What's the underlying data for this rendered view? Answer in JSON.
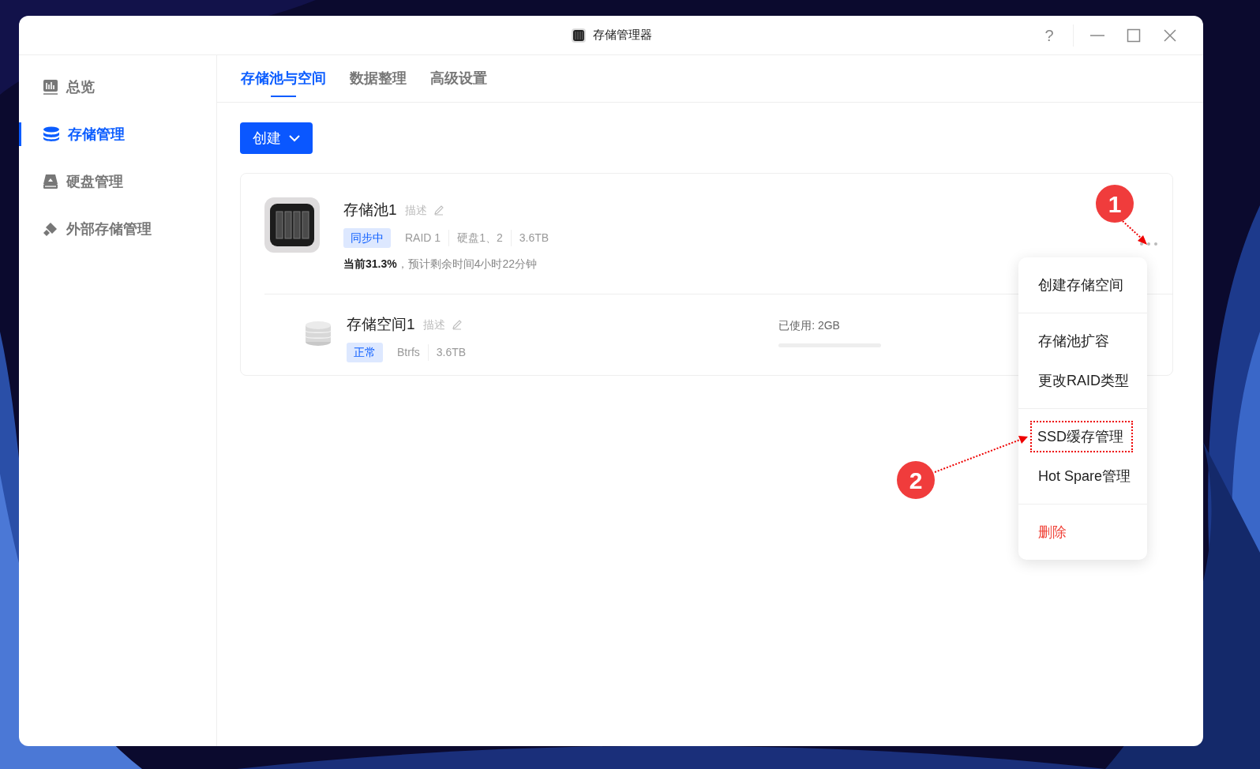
{
  "window": {
    "title": "存储管理器",
    "help": "?"
  },
  "sidebar": {
    "items": [
      {
        "label": "总览",
        "kind": "chart",
        "selected": false
      },
      {
        "label": "存储管理",
        "kind": "database",
        "selected": true
      },
      {
        "label": "硬盘管理",
        "kind": "drive",
        "selected": false
      },
      {
        "label": "外部存储管理",
        "kind": "plug",
        "selected": false
      }
    ]
  },
  "tabs": [
    {
      "label": "存储池与空间",
      "selected": true
    },
    {
      "label": "数据整理",
      "selected": false
    },
    {
      "label": "高级设置",
      "selected": false
    }
  ],
  "create_button": {
    "label": "创建"
  },
  "pool": {
    "name": "存储池1",
    "description": "描述",
    "status": "同步中",
    "raid": "RAID 1",
    "disks": "硬盘1、2",
    "size": "3.6TB",
    "progress": "**当前31.3%**，预计剩余时间4小时22分钟"
  },
  "volume": {
    "name": "存储空间1",
    "description": "描述",
    "status": "正常",
    "filesystem": "Btrfs",
    "size": "3.6TB",
    "used": "已使用: 2GB",
    "level": 0
  },
  "menu": {
    "groups": [
      {
        "items": [
          {
            "label": "创建存储空间",
            "kind": "normal",
            "highlighted": false
          }
        ]
      },
      {
        "items": [
          {
            "label": "存储池扩容",
            "kind": "normal",
            "highlighted": false
          },
          {
            "label": "更改RAID类型",
            "kind": "normal",
            "highlighted": false
          }
        ]
      },
      {
        "items": [
          {
            "label": "SSD缓存管理",
            "kind": "normal",
            "highlighted": true
          },
          {
            "label": "Hot Spare管理",
            "kind": "normal",
            "highlighted": false
          }
        ]
      },
      {
        "items": [
          {
            "label": "删除",
            "kind": "danger",
            "highlighted": false
          }
        ]
      }
    ]
  },
  "annotations": [
    {
      "label": "1"
    },
    {
      "label": "2"
    }
  ]
}
